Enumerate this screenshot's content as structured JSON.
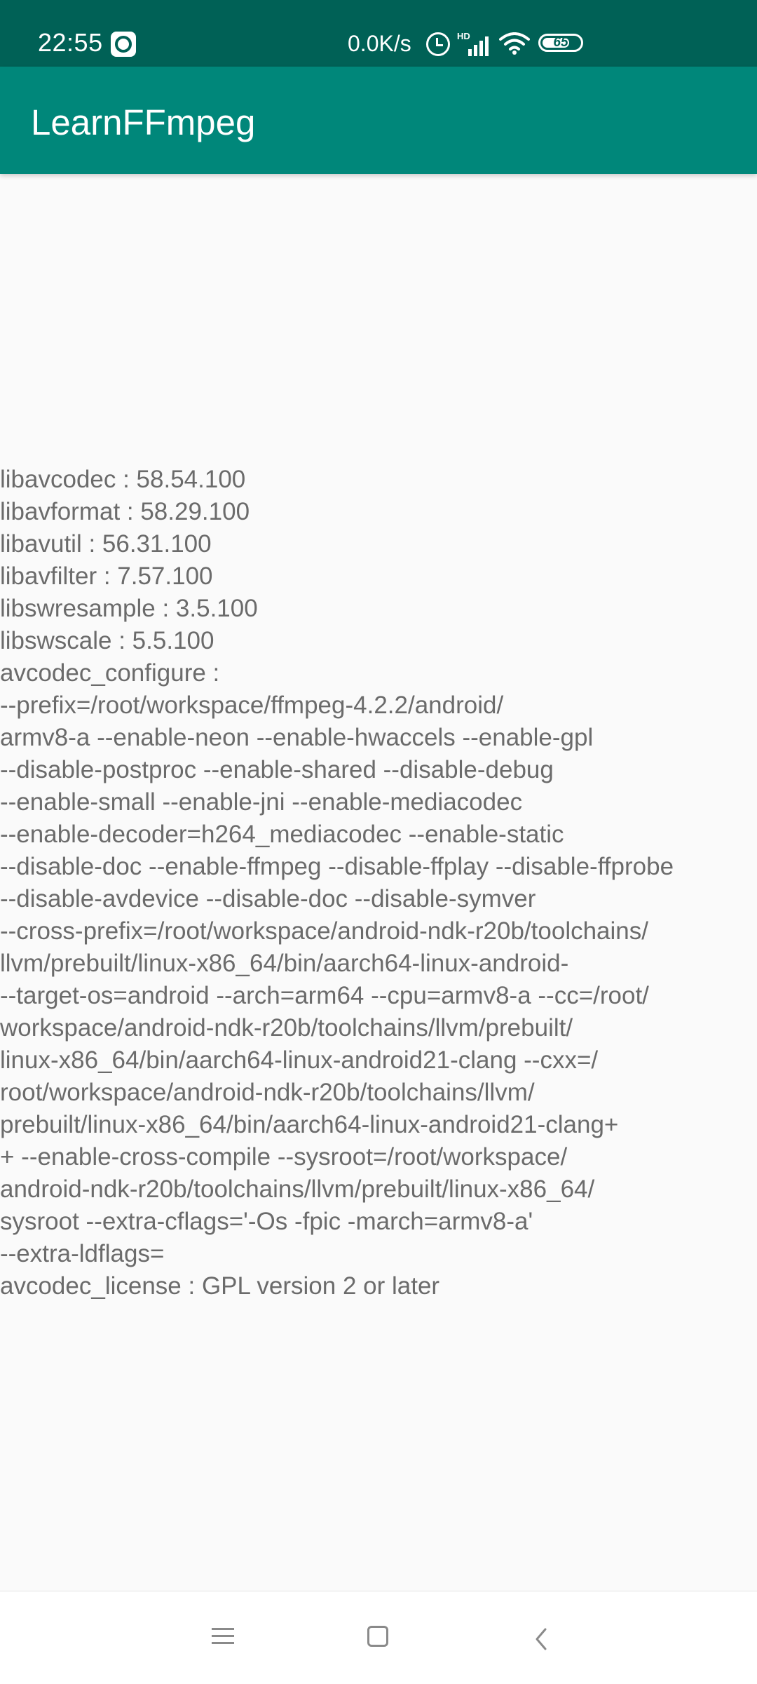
{
  "status_bar": {
    "time": "22:55",
    "network_speed": "0.0K/s",
    "signal_label": "HD",
    "battery_level": "65",
    "app_icon": "notification-app-icon",
    "alarm_icon": "alarm-icon",
    "signal_icon": "signal-icon",
    "wifi_icon": "wifi-icon",
    "battery_icon": "battery-icon"
  },
  "app_bar": {
    "title": "LearnFFmpeg",
    "color": "#00877a"
  },
  "content": {
    "lines": [
      "libavcodec : 58.54.100",
      "libavformat : 58.29.100",
      "libavutil : 56.31.100",
      "libavfilter : 7.57.100",
      "libswresample : 3.5.100",
      "libswscale : 5.5.100",
      "avcodec_configure :",
      "--prefix=/root/workspace/ffmpeg-4.2.2/android/",
      "armv8-a --enable-neon --enable-hwaccels --enable-gpl",
      "--disable-postproc --enable-shared --disable-debug",
      "--enable-small --enable-jni --enable-mediacodec",
      "--enable-decoder=h264_mediacodec --enable-static",
      "--disable-doc --enable-ffmpeg --disable-ffplay --disable-ffprobe",
      "--disable-avdevice --disable-doc --disable-symver",
      "--cross-prefix=/root/workspace/android-ndk-r20b/toolchains/",
      "llvm/prebuilt/linux-x86_64/bin/aarch64-linux-android-",
      "--target-os=android --arch=arm64 --cpu=armv8-a --cc=/root/",
      "workspace/android-ndk-r20b/toolchains/llvm/prebuilt/",
      "linux-x86_64/bin/aarch64-linux-android21-clang --cxx=/",
      "root/workspace/android-ndk-r20b/toolchains/llvm/",
      "prebuilt/linux-x86_64/bin/aarch64-linux-android21-clang+",
      "+ --enable-cross-compile --sysroot=/root/workspace/",
      "android-ndk-r20b/toolchains/llvm/prebuilt/linux-x86_64/",
      "sysroot --extra-cflags='-Os -fpic -march=armv8-a'",
      "--extra-ldflags=",
      "avcodec_license : GPL version 2 or later"
    ]
  },
  "nav_bar": {
    "menu_icon": "menu-icon",
    "home_icon": "home-icon",
    "back_icon": "back-icon"
  }
}
